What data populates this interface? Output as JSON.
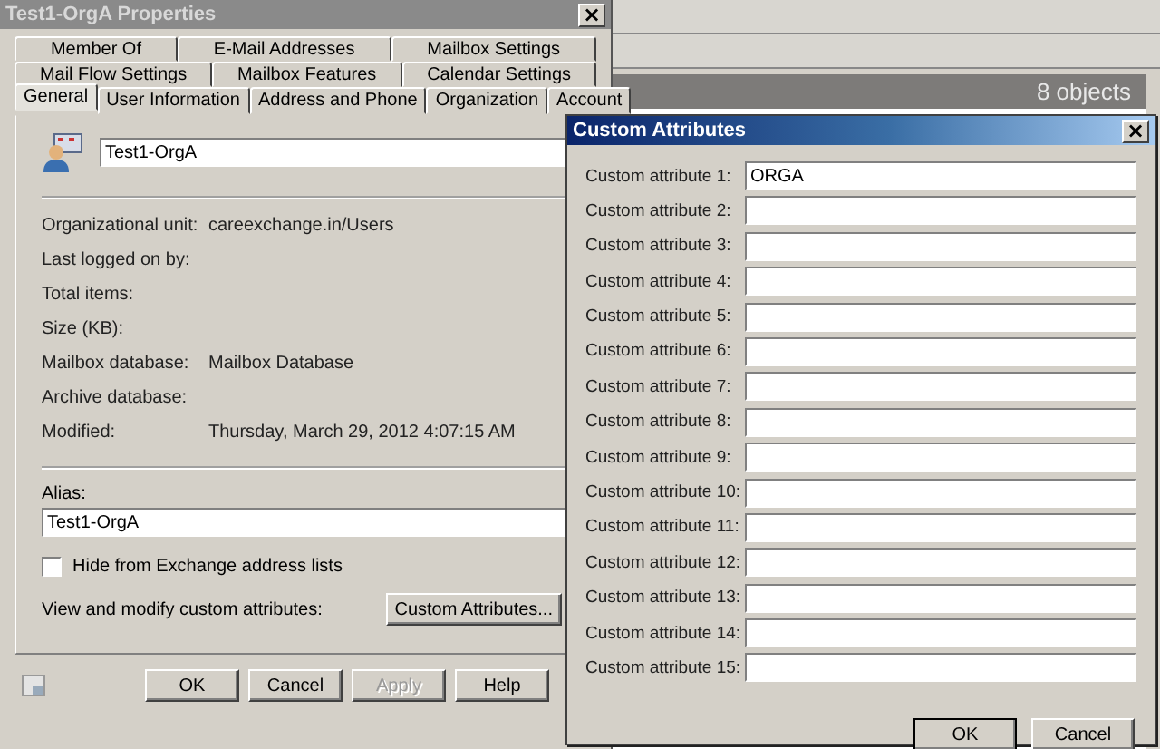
{
  "console": {
    "status": "8 objects"
  },
  "properties_window": {
    "title": "Test1-OrgA Properties",
    "tab_rows": [
      [
        {
          "label": "Member Of",
          "selected": false
        },
        {
          "label": "E-Mail Addresses",
          "selected": false
        },
        {
          "label": "Mailbox Settings",
          "selected": false
        }
      ],
      [
        {
          "label": "Mail Flow Settings",
          "selected": false
        },
        {
          "label": "Mailbox Features",
          "selected": false
        },
        {
          "label": "Calendar Settings",
          "selected": false
        }
      ],
      [
        {
          "label": "General",
          "selected": true
        },
        {
          "label": "User Information",
          "selected": false
        },
        {
          "label": "Address and Phone",
          "selected": false
        },
        {
          "label": "Organization",
          "selected": false
        },
        {
          "label": "Account",
          "selected": false
        }
      ]
    ],
    "display_name": "Test1-OrgA",
    "info": [
      {
        "label": "Organizational unit:",
        "value": "careexchange.in/Users"
      },
      {
        "label": "Last logged on by:"
      },
      {
        "label": "Total items:"
      },
      {
        "label": "Size (KB):"
      },
      {
        "label": "Mailbox database:",
        "value": "Mailbox Database"
      },
      {
        "label": "Archive database:"
      },
      {
        "label": "Modified:",
        "value": "Thursday, March 29, 2012 4:07:15 AM"
      }
    ],
    "alias": {
      "label": "Alias:",
      "value": "Test1-OrgA"
    },
    "hide_checkbox": {
      "label": "Hide from Exchange address lists",
      "checked": false
    },
    "custom_attributes": {
      "label": "View and modify custom attributes:",
      "button": "Custom Attributes..."
    },
    "buttons": [
      {
        "label": "OK",
        "disabled": false
      },
      {
        "label": "Cancel",
        "disabled": false
      },
      {
        "label": "Apply",
        "disabled": true
      },
      {
        "label": "Help",
        "disabled": false
      }
    ]
  },
  "custom_attributes_dialog": {
    "title": "Custom Attributes",
    "close": "×",
    "fields": [
      {
        "label": "Custom attribute 1:",
        "value": "ORGA"
      },
      {
        "label": "Custom attribute 2:"
      },
      {
        "label": "Custom attribute 3:"
      },
      {
        "label": "Custom attribute 4:"
      },
      {
        "label": "Custom attribute 5:"
      },
      {
        "label": "Custom attribute 6:"
      },
      {
        "label": "Custom attribute 7:"
      },
      {
        "label": "Custom attribute 8:"
      },
      {
        "label": "Custom attribute 9:"
      },
      {
        "label": "Custom attribute 10:"
      },
      {
        "label": "Custom attribute 11:"
      },
      {
        "label": "Custom attribute 12:"
      },
      {
        "label": "Custom attribute 13:"
      },
      {
        "label": "Custom attribute 14:"
      },
      {
        "label": "Custom attribute 15:"
      }
    ],
    "buttons": [
      "OK",
      "Cancel"
    ]
  },
  "properties_close": "×"
}
